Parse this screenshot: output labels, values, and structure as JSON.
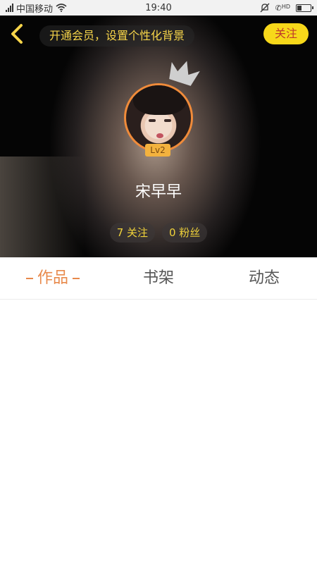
{
  "status_bar": {
    "carrier": "中国移动",
    "time": "19:40",
    "network": "HD",
    "battery_level": 0.35
  },
  "header": {
    "back_icon": "chevron-left-icon",
    "vip_banner": "开通会员，设置个性化背景",
    "follow_label": "关注"
  },
  "profile": {
    "level": "Lv2",
    "username": "宋早早",
    "following": "7 关注",
    "fans": "0 粉丝"
  },
  "tabs": [
    {
      "label": "作品",
      "active": true
    },
    {
      "label": "书架",
      "active": false
    },
    {
      "label": "动态",
      "active": false
    }
  ],
  "colors": {
    "accent_orange": "#e8894b",
    "vip_yellow": "#f7d54a",
    "follow_bg": "#f7d81a",
    "avatar_border": "#f08b3a"
  }
}
